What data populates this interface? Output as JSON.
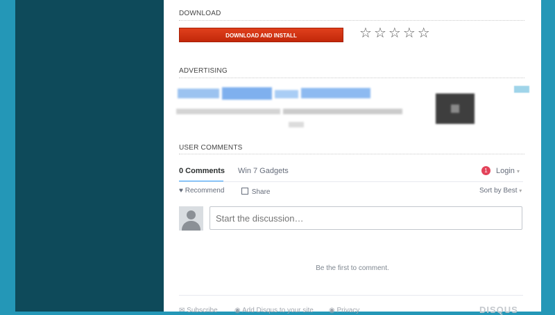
{
  "sections": {
    "download": "DOWNLOAD",
    "advertising": "ADVERTISING",
    "user_comments": "USER COMMENTS"
  },
  "download": {
    "button_label": "DOWNLOAD AND INSTALL",
    "rating_stars": 5,
    "rating_value": 0,
    "star_glyph": "☆"
  },
  "comments": {
    "tab_count": "0 Comments",
    "tab_site": "Win 7 Gadgets",
    "notification_count": "1",
    "login": "Login",
    "login_caret": "▾",
    "recommend": "Recommend",
    "share": "Share",
    "sort": "Sort by Best",
    "sort_caret": "▾",
    "input_placeholder": "Start the discussion…",
    "empty_message": "Be the first to comment.",
    "footer": {
      "subscribe": "Subscribe",
      "add_disqus": "Add Disqus to your site",
      "privacy": "Privacy",
      "brand": "DISQUS"
    }
  },
  "colors": {
    "page_bg": "#2497b7",
    "left_panel": "#0e4a5a",
    "download_button": "#d2340f",
    "accent_tab": "#2e9fff",
    "badge": "#e3435a"
  },
  "icons": {
    "heart": "heart-icon",
    "share": "share-icon",
    "avatar": "default-avatar"
  }
}
